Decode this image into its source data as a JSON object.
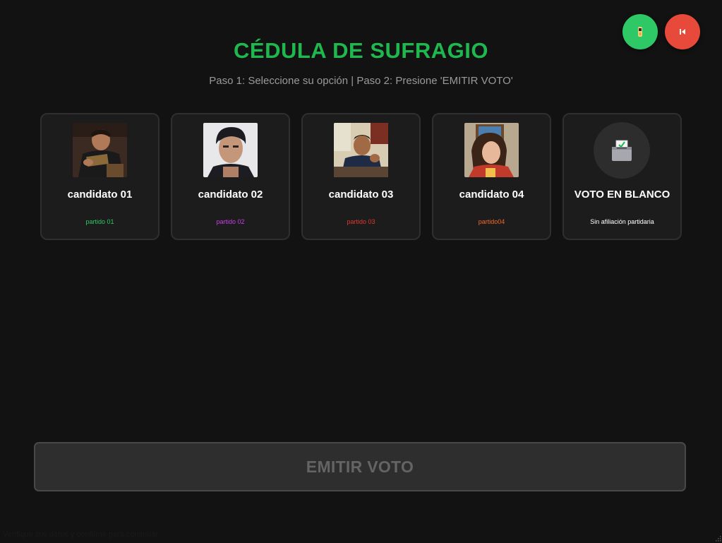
{
  "header": {
    "title": "CÉDULA DE SUFRAGIO",
    "subtitle": "Paso 1: Seleccione su opción | Paso 2: Presione 'EMITIR VOTO'"
  },
  "corner_buttons": {
    "left_icon": "person-accessibility-icon",
    "right_icon": "back-arrow-icon",
    "left_color": "#2ec866",
    "right_color": "#e74a3b"
  },
  "candidates": [
    {
      "name": "candidato 01",
      "party": "partido 01",
      "party_color": "#2ec866",
      "photo_icon": "candidate-photo"
    },
    {
      "name": "candidato 02",
      "party": "partido 02",
      "party_color": "#c640e8",
      "photo_icon": "candidate-photo"
    },
    {
      "name": "candidato 03",
      "party": "partido 03",
      "party_color": "#e03a2f",
      "photo_icon": "candidate-photo"
    },
    {
      "name": "candidato 04",
      "party": "partido04",
      "party_color": "#f06a2a",
      "photo_icon": "candidate-photo"
    },
    {
      "name": "VOTO EN BLANCO",
      "party": "Sin afiliación partidaria",
      "party_color": "#ffffff",
      "photo_icon": "ballot-box-icon"
    }
  ],
  "actions": {
    "emit_label": "EMITIR VOTO"
  },
  "footer": {
    "note": "Verifique sus datos y confirme para continuar."
  },
  "colors": {
    "accent_green": "#1fb84f",
    "background": "#121212",
    "card": "#1c1c1c"
  }
}
